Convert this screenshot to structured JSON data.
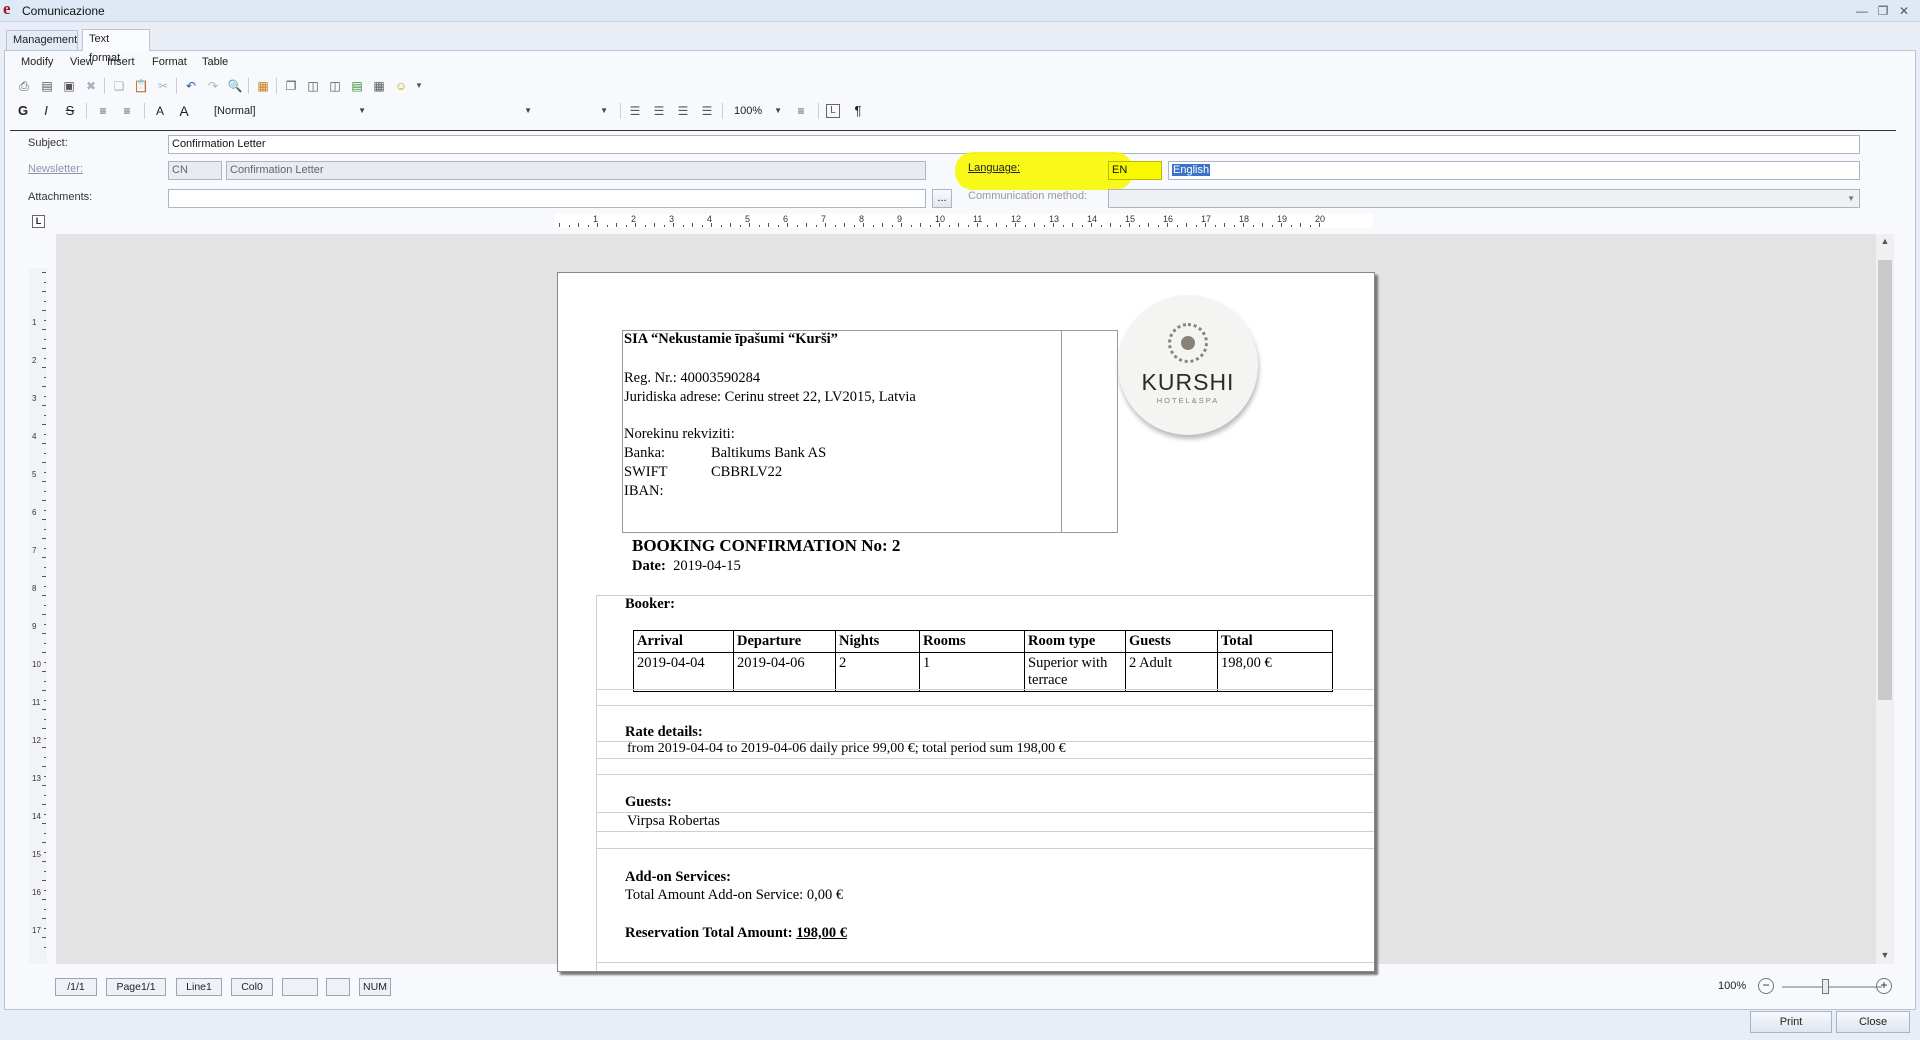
{
  "window": {
    "title": "Comunicazione",
    "logo_letter": "e"
  },
  "tabs": [
    {
      "label": "Management"
    },
    {
      "label": "Text format"
    }
  ],
  "menu": [
    "Modify",
    "View",
    "Insert",
    "Format",
    "Table"
  ],
  "toolbar": {
    "style_value": "[Normal]",
    "font_value": "",
    "size_value": "",
    "zoom_value": "100%",
    "bold": "G",
    "italic": "I",
    "strike": "S",
    "grow": "A",
    "shrink": "A",
    "para": "¶"
  },
  "form": {
    "subject_label": "Subject:",
    "subject_value": "Confirmation Letter",
    "newsletter_label": "Newsletter:",
    "newsletter_code": "CN",
    "newsletter_name": "Confirmation Letter",
    "language_label": "Language:",
    "language_code": "EN",
    "language_name": "English",
    "attachments_label": "Attachments:",
    "attachments_value": "",
    "browse_label": "...",
    "comm_method_label": "Communication method:",
    "comm_method_value": ""
  },
  "ruler": {
    "numbers": [
      "1",
      "2",
      "3",
      "4",
      "5",
      "6",
      "7",
      "8",
      "9",
      "10",
      "11",
      "12",
      "13",
      "14",
      "15",
      "16",
      "17",
      "18",
      "19",
      "20"
    ]
  },
  "vruler": {
    "numbers": [
      "1",
      "2",
      "3",
      "4",
      "5",
      "6",
      "7",
      "8",
      "9",
      "10",
      "11",
      "12",
      "13",
      "14",
      "15",
      "16",
      "17"
    ]
  },
  "document": {
    "company": "SIA “Nekustamie īpašumi “Kurši”",
    "reg_nr": "Reg. Nr.: 40003590284",
    "address": "Juridiska adrese: Cerinu street 22, LV2015, Latvia",
    "bank_header": "Norekinu rekviziti:",
    "bank_label": "Banka:",
    "bank_value": "Baltikums Bank AS",
    "swift_label": "SWIFT",
    "swift_value": "CBBRLV22",
    "iban_label": "IBAN:",
    "logo_name": "KURSHI",
    "logo_sub": "HOTEL&SPA",
    "confirmation_label": "BOOKING CONFIRMATION No:",
    "confirmation_no": "2",
    "date_label": "Date:",
    "date_value": "2019-04-15",
    "booker_label": "Booker:",
    "table_headers": [
      "Arrival",
      "Departure",
      "Nights",
      "Rooms",
      "Room type",
      "Guests",
      "Total"
    ],
    "table_row": [
      "2019-04-04",
      "2019-04-06",
      "2",
      "1",
      "Superior with terrace",
      "2 Adult",
      "198,00  €"
    ],
    "rate_label": "Rate details:",
    "rate_text": "from 2019-04-04 to 2019-04-06 daily price 99,00 €; total period sum 198,00 €",
    "guests_label": "Guests:",
    "guest_name": "Virpsa Robertas",
    "addon_label": "Add-on Services:",
    "addon_total": "Total Amount Add-on Service: 0,00  €",
    "reservation_label": "Reservation Total Amount:",
    "reservation_total": "198,00 €"
  },
  "statusbar": {
    "page_pos": "/1/1",
    "page": "Page1/1",
    "line": "Line1",
    "col": "Col0",
    "box1": "",
    "box2": "",
    "num": "NUM",
    "zoom": "100%"
  },
  "buttons": {
    "print": "Print",
    "close": "Close"
  }
}
